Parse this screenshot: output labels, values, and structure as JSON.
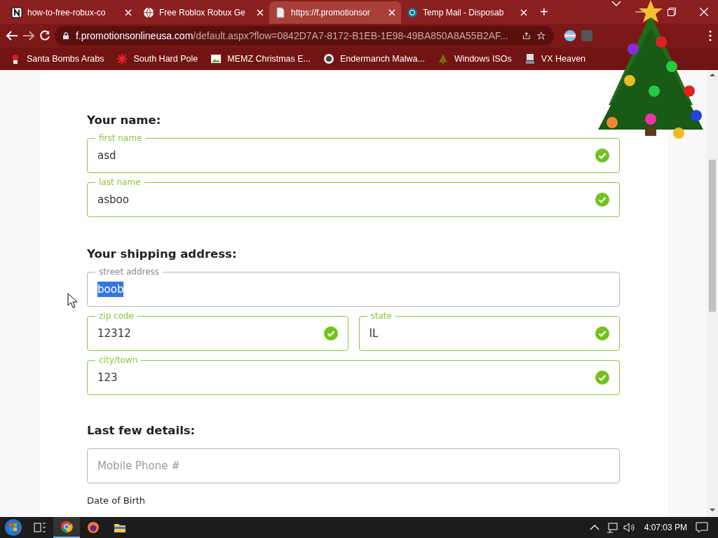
{
  "browser": {
    "tabs": [
      {
        "title": "how-to-free-robux-co",
        "selected": false
      },
      {
        "title": "Free Roblox Robux Ge",
        "selected": false
      },
      {
        "title": "https://f.promotionsor",
        "selected": true
      },
      {
        "title": "Temp Mail - Disposab",
        "selected": false
      }
    ],
    "new_tab": "+",
    "address": {
      "domain": "f.promotionsonlineusa.com",
      "path": "/default.aspx?flow=0842D7A7-8172-B1EB-1E98-49BA850A8A55B2AF..."
    },
    "bookmarks": [
      {
        "label": "Santa Bombs Arabs"
      },
      {
        "label": "South Hard Pole"
      },
      {
        "label": "MEMZ Christmas E..."
      },
      {
        "label": "Endermanch Malwa..."
      },
      {
        "label": "Windows ISOs"
      },
      {
        "label": "VX Heaven"
      }
    ]
  },
  "page": {
    "sections": [
      {
        "title": "Your name:",
        "rows": [
          [
            {
              "label": "first name",
              "value": "asd",
              "valid": true,
              "highlighted": false
            }
          ],
          [
            {
              "label": "last name",
              "value": "asboo",
              "valid": true,
              "highlighted": false
            }
          ]
        ]
      },
      {
        "title": "Your shipping address:",
        "rows": [
          [
            {
              "label": "street address",
              "value": "boob",
              "valid": false,
              "highlighted": true
            }
          ],
          [
            {
              "label": "zip code",
              "value": "12312",
              "valid": true,
              "highlighted": false
            },
            {
              "label": "state",
              "value": "IL",
              "valid": true,
              "highlighted": false
            }
          ],
          [
            {
              "label": "city/town",
              "value": "123",
              "valid": true,
              "highlighted": false
            }
          ]
        ]
      },
      {
        "title": "Last few details:",
        "rows": [
          [
            {
              "placeholder": "Mobile Phone #",
              "valid": false
            }
          ]
        ]
      }
    ],
    "trailing_label": "Date of Birth"
  },
  "taskbar": {
    "apps": [
      {
        "active": false
      },
      {
        "active": false
      },
      {
        "active": true
      },
      {
        "active": false
      },
      {
        "active": false
      }
    ],
    "clock": "4:07:03 PM"
  }
}
